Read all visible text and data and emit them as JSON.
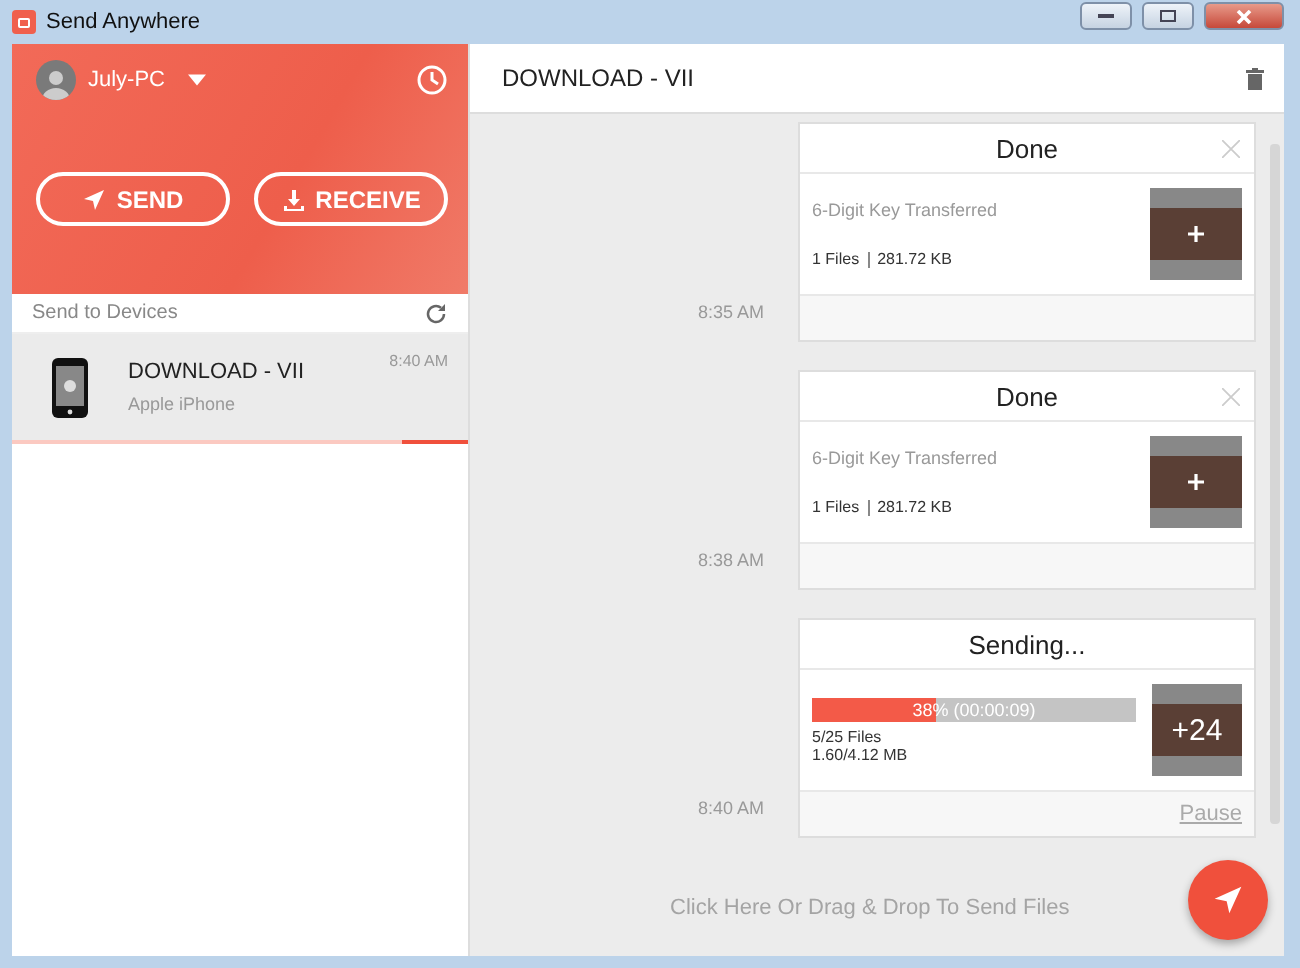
{
  "window": {
    "title": "Send Anywhere"
  },
  "profile": {
    "name": "July-PC"
  },
  "actions": [
    {
      "kind": "send",
      "label": "SEND"
    },
    {
      "kind": "receive",
      "label": "RECEIVE"
    }
  ],
  "devices_header": "Send to Devices",
  "devices": [
    {
      "name": "DOWNLOAD - VII",
      "model": "Apple iPhone",
      "time": "8:40 AM",
      "selected": true
    }
  ],
  "conversation": {
    "title": "DOWNLOAD - VII",
    "transfers": [
      {
        "kind": "done",
        "status": "Done",
        "time": "8:35 AM",
        "description": "6-Digit Key Transferred",
        "files": "1 Files",
        "size": "281.72 KB"
      },
      {
        "kind": "done",
        "status": "Done",
        "time": "8:38 AM",
        "description": "6-Digit Key Transferred",
        "files": "1 Files",
        "size": "281.72 KB"
      },
      {
        "kind": "sending",
        "status": "Sending...",
        "time": "8:40 AM",
        "level": 0.38,
        "progress_text": "38% (00:00:09)",
        "files": "5/25 Files",
        "size": "1.60/4.12 MB",
        "thumb_label": "+24",
        "action": "Pause"
      }
    ]
  },
  "drop_hint": "Click Here Or Drag & Drop To Send Files"
}
